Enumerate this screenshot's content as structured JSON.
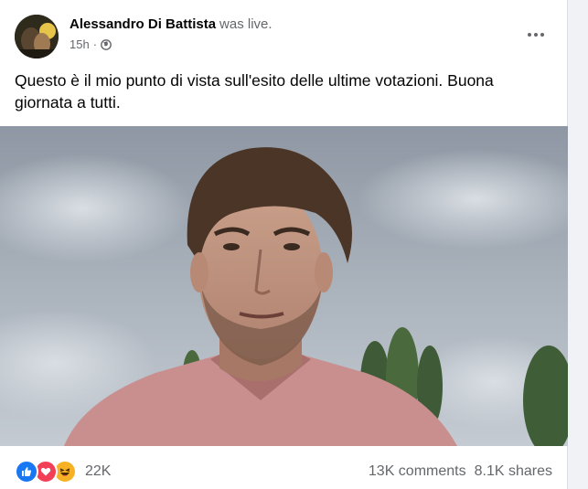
{
  "post": {
    "author": "Alessandro Di Battista",
    "action": "was live.",
    "time": "15h",
    "separator": "·",
    "audience_icon": "globe-icon",
    "more_icon": "more-options-icon",
    "text": "Questo è il mio punto di vista sull'esito delle ultime votazioni. Buona giornata a tutti."
  },
  "reactions": {
    "icons": [
      "like-reaction-icon",
      "love-reaction-icon",
      "haha-reaction-icon"
    ],
    "count": "22K",
    "like_color": "#1877f2",
    "love_color": "#f33e58",
    "haha_color": "#f7b125"
  },
  "stats": {
    "comments": "13K comments",
    "shares": "8.1K shares"
  }
}
